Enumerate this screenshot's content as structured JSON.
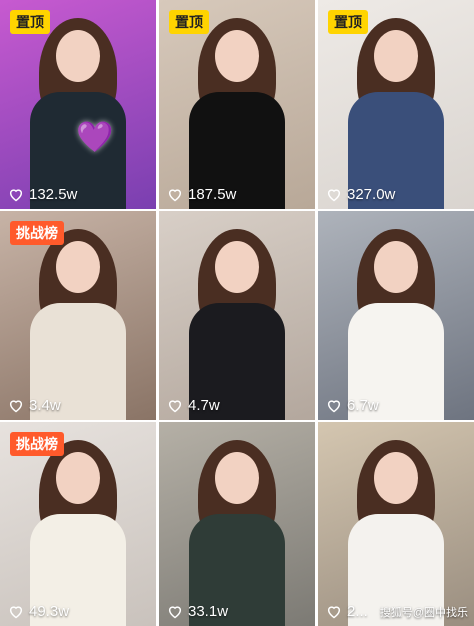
{
  "tiles": [
    {
      "badge": "置顶",
      "badge_type": "pin",
      "likes": "132.5w",
      "bg": "#7a3fb0",
      "bg2": "#c75ad0",
      "outfit": "#1f2a33"
    },
    {
      "badge": "置顶",
      "badge_type": "pin",
      "likes": "187.5w",
      "bg": "#b8a898",
      "bg2": "#d7c9bb",
      "outfit": "#111111"
    },
    {
      "badge": "置顶",
      "badge_type": "pin",
      "likes": "327.0w",
      "bg": "#d9d4cf",
      "bg2": "#eeeae6",
      "outfit": "#3a4f7a"
    },
    {
      "badge": "挑战榜",
      "badge_type": "challenge",
      "likes": "3.4w",
      "bg": "#8a7466",
      "bg2": "#c7b3a6",
      "outfit": "#e9e1d6"
    },
    {
      "badge": "",
      "badge_type": "",
      "likes": "4.7w",
      "bg": "#b3a79d",
      "bg2": "#d8cfc7",
      "outfit": "#1b1b1f"
    },
    {
      "badge": "",
      "badge_type": "",
      "likes": "6.7w",
      "bg": "#6e7480",
      "bg2": "#aeb3bb",
      "outfit": "#f6f4f0"
    },
    {
      "badge": "挑战榜",
      "badge_type": "challenge",
      "likes": "49.3w",
      "bg": "#c9c2bc",
      "bg2": "#e7e2de",
      "outfit": "#f3efe6"
    },
    {
      "badge": "",
      "badge_type": "",
      "likes": "33.1w",
      "bg": "#7c7a74",
      "bg2": "#b5b0a6",
      "outfit": "#2f3c37"
    },
    {
      "badge": "",
      "badge_type": "",
      "likes": "2...",
      "bg": "#9a8e80",
      "bg2": "#d4c6b0",
      "outfit": "#f4f2ee"
    }
  ],
  "watermark": "搜狐号@圈中找乐",
  "icons": {
    "like": "heart-outline-icon",
    "sticker": "purple-heart-icon"
  },
  "sticker": "💜"
}
